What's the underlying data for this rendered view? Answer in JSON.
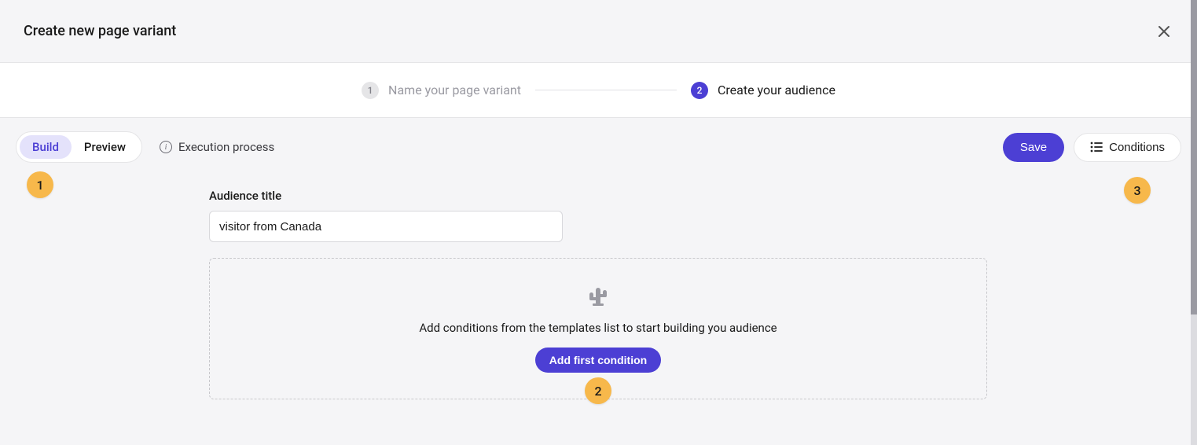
{
  "header": {
    "title": "Create new page variant"
  },
  "stepper": {
    "step1": {
      "num": "1",
      "label": "Name your page variant"
    },
    "step2": {
      "num": "2",
      "label": "Create your audience"
    }
  },
  "toolbar": {
    "segment": {
      "build": "Build",
      "preview": "Preview"
    },
    "exec_process": "Execution process",
    "save": "Save",
    "conditions": "Conditions"
  },
  "form": {
    "audience_title_label": "Audience title",
    "audience_title_value": "visitor from Canada"
  },
  "drop_area": {
    "message": "Add conditions from the templates list to start building you audience",
    "button": "Add first condition"
  },
  "callouts": {
    "c1": "1",
    "c2": "2",
    "c3": "3"
  }
}
